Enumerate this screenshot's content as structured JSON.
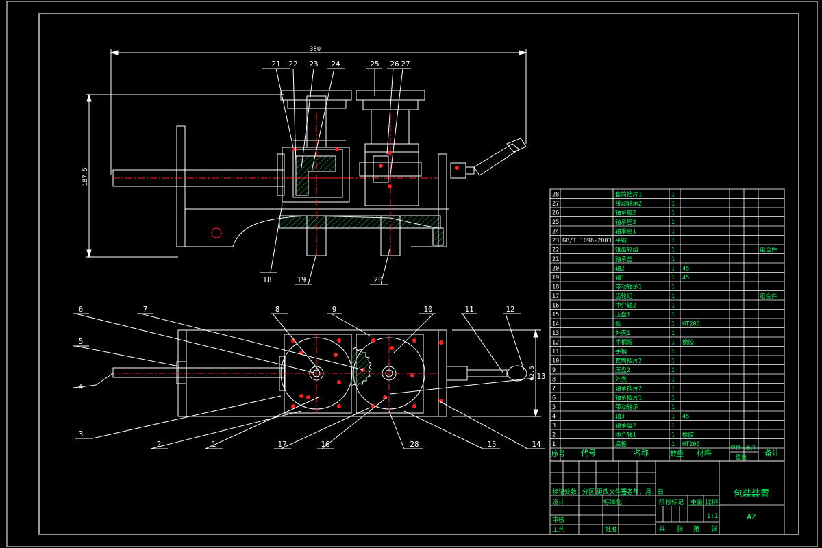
{
  "drawing": {
    "overall_width_dim": "380",
    "overall_height_dim": "187.5",
    "side_width_dim": "62.5",
    "balloons_top": [
      "21",
      "22",
      "23",
      "24",
      "25",
      "26",
      "27",
      "18",
      "19",
      "20"
    ],
    "balloons_bottom": [
      "6",
      "7",
      "5",
      "4",
      "3",
      "8",
      "9",
      "10",
      "11",
      "12",
      "13",
      "2",
      "1",
      "17",
      "16",
      "28",
      "15",
      "14"
    ]
  },
  "bom": {
    "rows": [
      {
        "no": "28",
        "code": "",
        "name": "套筒挡片1",
        "qty": "1",
        "material": "",
        "note": ""
      },
      {
        "no": "27",
        "code": "",
        "name": "带动轴承2",
        "qty": "1",
        "material": "",
        "note": ""
      },
      {
        "no": "26",
        "code": "",
        "name": "轴承座2",
        "qty": "1",
        "material": "",
        "note": ""
      },
      {
        "no": "25",
        "code": "",
        "name": "轴承座3",
        "qty": "1",
        "material": "",
        "note": ""
      },
      {
        "no": "24",
        "code": "",
        "name": "轴承座1",
        "qty": "1",
        "material": "",
        "note": ""
      },
      {
        "no": "23",
        "code": "GB/T 1096-2003",
        "name": "平键",
        "qty": "1",
        "material": "",
        "note": ""
      },
      {
        "no": "22",
        "code": "",
        "name": "锥齿轮组",
        "qty": "1",
        "material": "",
        "note": "组合件"
      },
      {
        "no": "21",
        "code": "",
        "name": "轴承盖",
        "qty": "1",
        "material": "",
        "note": ""
      },
      {
        "no": "20",
        "code": "",
        "name": "轴2",
        "qty": "1",
        "material": "45",
        "note": ""
      },
      {
        "no": "19",
        "code": "",
        "name": "轴1",
        "qty": "1",
        "material": "45",
        "note": ""
      },
      {
        "no": "18",
        "code": "",
        "name": "带动轴承1",
        "qty": "1",
        "material": "",
        "note": ""
      },
      {
        "no": "17",
        "code": "",
        "name": "齿轮组",
        "qty": "1",
        "material": "",
        "note": "组合件"
      },
      {
        "no": "16",
        "code": "",
        "name": "中介轴2",
        "qty": "1",
        "material": "",
        "note": ""
      },
      {
        "no": "15",
        "code": "",
        "name": "压盘1",
        "qty": "1",
        "material": "",
        "note": ""
      },
      {
        "no": "14",
        "code": "",
        "name": "板",
        "qty": "1",
        "material": "HT200",
        "note": ""
      },
      {
        "no": "13",
        "code": "",
        "name": "外壳1",
        "qty": "1",
        "material": "",
        "note": ""
      },
      {
        "no": "12",
        "code": "",
        "name": "手柄帽",
        "qty": "1",
        "material": "橡胶",
        "note": ""
      },
      {
        "no": "11",
        "code": "",
        "name": "手柄",
        "qty": "1",
        "material": "",
        "note": ""
      },
      {
        "no": "10",
        "code": "",
        "name": "套筒挡片2",
        "qty": "1",
        "material": "",
        "note": ""
      },
      {
        "no": "9",
        "code": "",
        "name": "压盘2",
        "qty": "1",
        "material": "",
        "note": ""
      },
      {
        "no": "8",
        "code": "",
        "name": "外壳",
        "qty": "1",
        "material": "",
        "note": ""
      },
      {
        "no": "7",
        "code": "",
        "name": "轴承挡片2",
        "qty": "1",
        "material": "",
        "note": ""
      },
      {
        "no": "6",
        "code": "",
        "name": "轴承挡片1",
        "qty": "1",
        "material": "",
        "note": ""
      },
      {
        "no": "5",
        "code": "",
        "name": "带动轴承",
        "qty": "1",
        "material": "",
        "note": ""
      },
      {
        "no": "4",
        "code": "",
        "name": "轴3",
        "qty": "1",
        "material": "45",
        "note": ""
      },
      {
        "no": "3",
        "code": "",
        "name": "轴承座2",
        "qty": "1",
        "material": "",
        "note": ""
      },
      {
        "no": "2",
        "code": "",
        "name": "中介轴1",
        "qty": "1",
        "material": "橡胶",
        "note": ""
      },
      {
        "no": "1",
        "code": "",
        "name": "底板",
        "qty": "1",
        "material": "HT200",
        "note": ""
      }
    ],
    "header": {
      "no": "序号",
      "code": "代号",
      "name": "名称",
      "qty": "数量",
      "material": "材料",
      "unit": "单件",
      "total": "总计",
      "weight": "重量",
      "note": "备注"
    }
  },
  "title_block": {
    "title": "包装装置",
    "sheet": "A2",
    "labels": {
      "mark": "标记",
      "count": "处数",
      "zone": "分区",
      "change_doc": "更改文件号",
      "signature": "签名",
      "date": "年、月、日",
      "design": "设计",
      "standard": "标准化",
      "stage": "阶段标记",
      "weight": "重量",
      "scale": "比例",
      "scale_value": "1:1",
      "review": "审核",
      "process": "工艺",
      "approve": "批准",
      "total_sheets": "共",
      "sheets1": "张",
      "page": "第",
      "sheets2": "张"
    }
  },
  "colors": {
    "background": "#000000",
    "line": "#ffffff",
    "center_line": "#ff2222",
    "text": "#00ff66",
    "hatch": "#00ff66",
    "dim": "#ffffff"
  }
}
